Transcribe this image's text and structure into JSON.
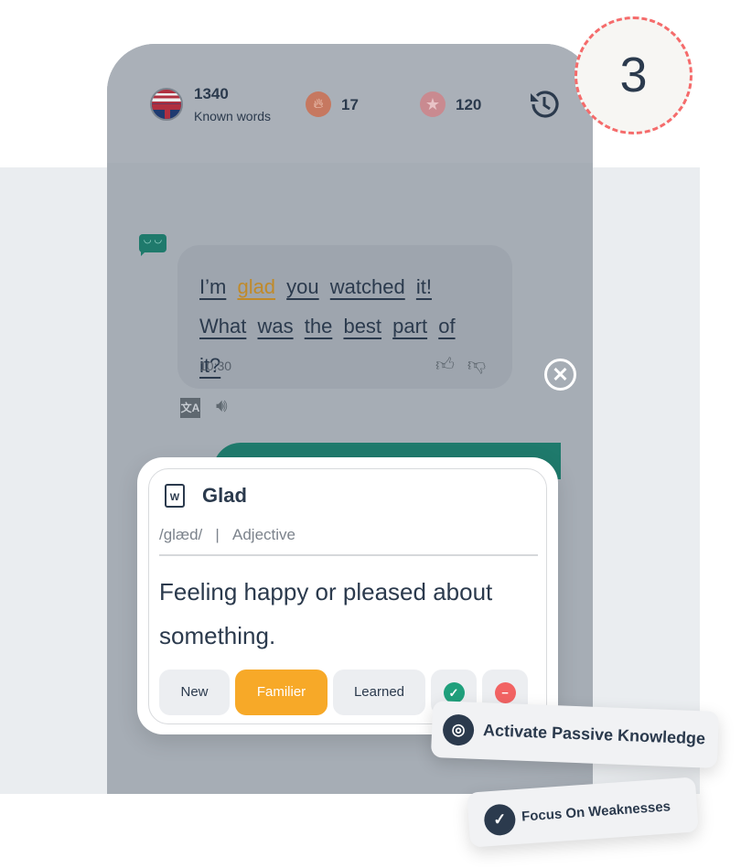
{
  "header": {
    "known_words_count": "1340",
    "known_words_label": "Known words",
    "streak": "17",
    "stars": "120",
    "history_icon": "history-icon",
    "flag_icon": "us-uk-flag-icon"
  },
  "step_badge": "3",
  "message": {
    "words": [
      {
        "t": "I’m"
      },
      {
        "t": "glad",
        "highlight": true
      },
      {
        "t": "you"
      },
      {
        "t": "watched"
      },
      {
        "t": "it!"
      },
      {
        "t": "What"
      },
      {
        "t": "was"
      },
      {
        "t": "the"
      },
      {
        "t": "best"
      },
      {
        "t": "part"
      },
      {
        "t": "of"
      },
      {
        "t": "it?"
      }
    ],
    "time": "10:30",
    "highlight_color": "#c08a2a"
  },
  "popup": {
    "word": "Glad",
    "phonetic": "/glæd/",
    "divider": "|",
    "part_of_speech": "Adjective",
    "definition": "Feeling happy or pleased about something.",
    "buttons": {
      "new": "New",
      "familiar": "Familier",
      "learned": "Learned"
    },
    "selected": "Familier",
    "accent": "#f7a928"
  },
  "tags": {
    "activate": "Activate Passive Knowledge",
    "focus": "Focus On Weaknesses"
  },
  "colors": {
    "teal": "#1f7a6c",
    "known_green": "#1fa07c",
    "remove_red": "#f26363",
    "badge_dash": "#f56b6b"
  }
}
